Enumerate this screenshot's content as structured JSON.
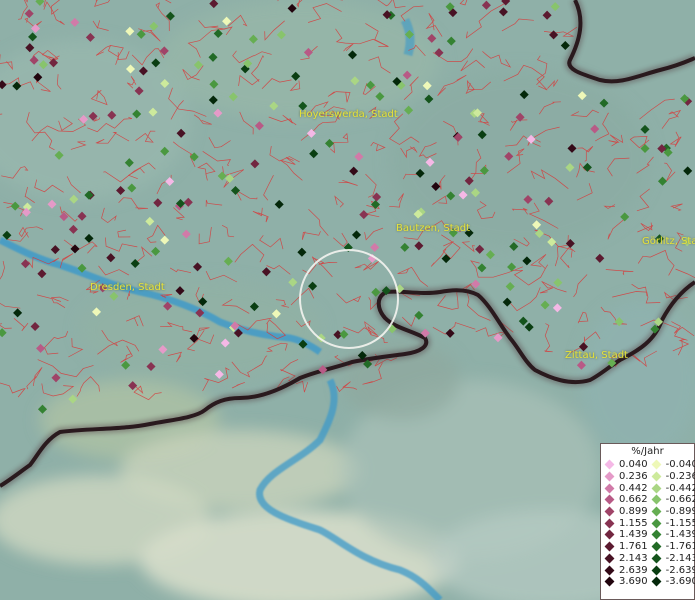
{
  "cities": [
    {
      "name": "Hoyerswerda, Stadt"
    },
    {
      "name": "Bautzen, Stadt"
    },
    {
      "name": "Görlitz, Stadt"
    },
    {
      "name": "Dresden, Stadt"
    },
    {
      "name": "Zittau, Stadt"
    }
  ],
  "legend": {
    "title": "%/Jahr",
    "positive": [
      {
        "label": "0.040",
        "color": "#f5b8e6"
      },
      {
        "label": "0.236",
        "color": "#e59ac8"
      },
      {
        "label": "0.442",
        "color": "#d17aa8"
      },
      {
        "label": "0.662",
        "color": "#b85a86"
      },
      {
        "label": "0.899",
        "color": "#a04468"
      },
      {
        "label": "1.155",
        "color": "#883352"
      },
      {
        "label": "1.439",
        "color": "#722640"
      },
      {
        "label": "1.761",
        "color": "#5c1a30"
      },
      {
        "label": "2.143",
        "color": "#481224"
      },
      {
        "label": "2.639",
        "color": "#340a18"
      },
      {
        "label": "3.690",
        "color": "#22050e"
      }
    ],
    "negative": [
      {
        "label": "-0.040",
        "color": "#eef8b8"
      },
      {
        "label": "-0.236",
        "color": "#cdea9c"
      },
      {
        "label": "-0.442",
        "color": "#aad684"
      },
      {
        "label": "-0.662",
        "color": "#88c46c"
      },
      {
        "label": "-0.899",
        "color": "#66ae52"
      },
      {
        "label": "-1.155",
        "color": "#4a9840"
      },
      {
        "label": "-1.439",
        "color": "#348232"
      },
      {
        "label": "-1.761",
        "color": "#226a26"
      },
      {
        "label": "-2.143",
        "color": "#14541c"
      },
      {
        "label": "-2.639",
        "color": "#0a3e12"
      },
      {
        "label": "-3.690",
        "color": "#04280a"
      }
    ]
  },
  "colors": {
    "background": "#8fb0a8",
    "boundaries": "#d83a3a",
    "border": "#2a1a1e",
    "water": "#3e9ac8",
    "city_label": "#e6e23a"
  }
}
